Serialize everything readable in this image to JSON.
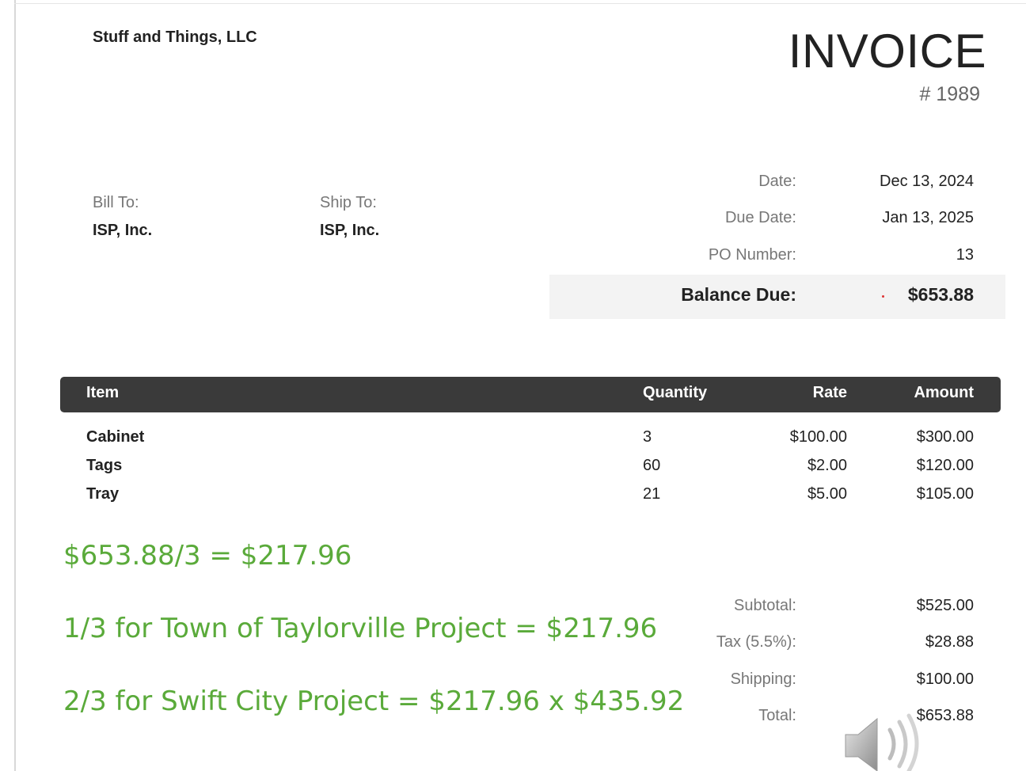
{
  "company": "Stuff and Things, LLC",
  "invoice": {
    "title": "INVOICE",
    "number": "# 1989"
  },
  "bill_to": {
    "label": "Bill To:",
    "name": "ISP, Inc."
  },
  "ship_to": {
    "label": "Ship To:",
    "name": "ISP, Inc."
  },
  "meta": [
    {
      "label": "Date:",
      "value": "Dec 13, 2024"
    },
    {
      "label": "Due Date:",
      "value": "Jan 13, 2025"
    },
    {
      "label": "PO Number:",
      "value": "13"
    }
  ],
  "balance": {
    "label": "Balance Due:",
    "value": "$653.88"
  },
  "table": {
    "headers": {
      "item": "Item",
      "quantity": "Quantity",
      "rate": "Rate",
      "amount": "Amount"
    },
    "rows": [
      {
        "item": "Cabinet",
        "quantity": "3",
        "rate": "$100.00",
        "amount": "$300.00"
      },
      {
        "item": "Tags",
        "quantity": "60",
        "rate": "$2.00",
        "amount": "$120.00"
      },
      {
        "item": "Tray",
        "quantity": "21",
        "rate": "$5.00",
        "amount": "$105.00"
      }
    ]
  },
  "notes": [
    "$653.88/3 = $217.96",
    "1/3 for Town of Taylorville Project = $217.96",
    "2/3 for Swift City Project = $217.96 x $435.92"
  ],
  "summary": [
    {
      "label": "Subtotal:",
      "value": "$525.00"
    },
    {
      "label": "Tax (5.5%):",
      "value": "$28.88"
    },
    {
      "label": "Shipping:",
      "value": "$100.00"
    },
    {
      "label": "Total:",
      "value": "$653.88"
    }
  ],
  "icons": {
    "audio": "speaker-icon"
  },
  "colors": {
    "header_bg": "#3a3a3a",
    "note_green": "#5aaa3a",
    "balance_bg": "#f3f3f3"
  }
}
